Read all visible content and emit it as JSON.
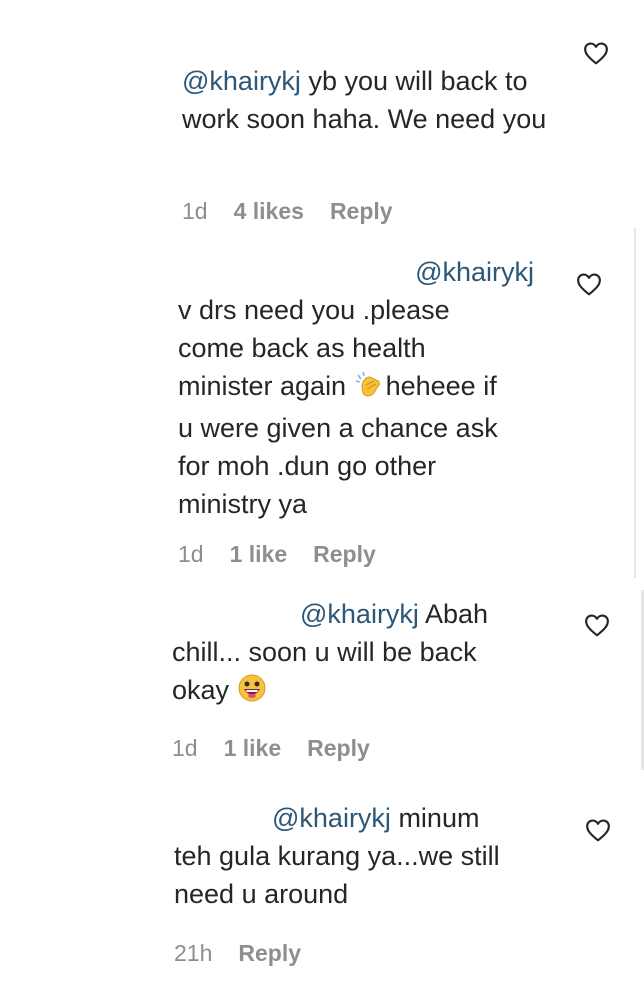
{
  "comments": [
    {
      "mention": "@khairykj",
      "text": " yb you will back to work soon haha. We need you",
      "time": "1d",
      "likes": "4 likes",
      "reply": "Reply"
    },
    {
      "mention": "@khairykj",
      "text_line1": "v drs need you .please come back as health minister again ",
      "emoji": "clapping-hands-icon",
      "text_line2": "heheee if u were given a chance ask for moh .dun go other ministry ya",
      "time": "1d",
      "likes": "1 like",
      "reply": "Reply"
    },
    {
      "mention": "@khairykj",
      "text_a": " Abah",
      "text_b": "chill... soon u will be back",
      "text_c": "okay ",
      "emoji": "grinning-face-icon",
      "time": "1d",
      "likes": "1 like",
      "reply": "Reply"
    },
    {
      "mention": "@khairykj",
      "text_a": " minum",
      "text_b": "teh gula kurang ya...we still",
      "text_c": "need u around",
      "time": "21h",
      "reply": "Reply"
    }
  ],
  "colors": {
    "mention": "#2c5777",
    "text": "#262626",
    "meta": "#8e8e8e"
  }
}
